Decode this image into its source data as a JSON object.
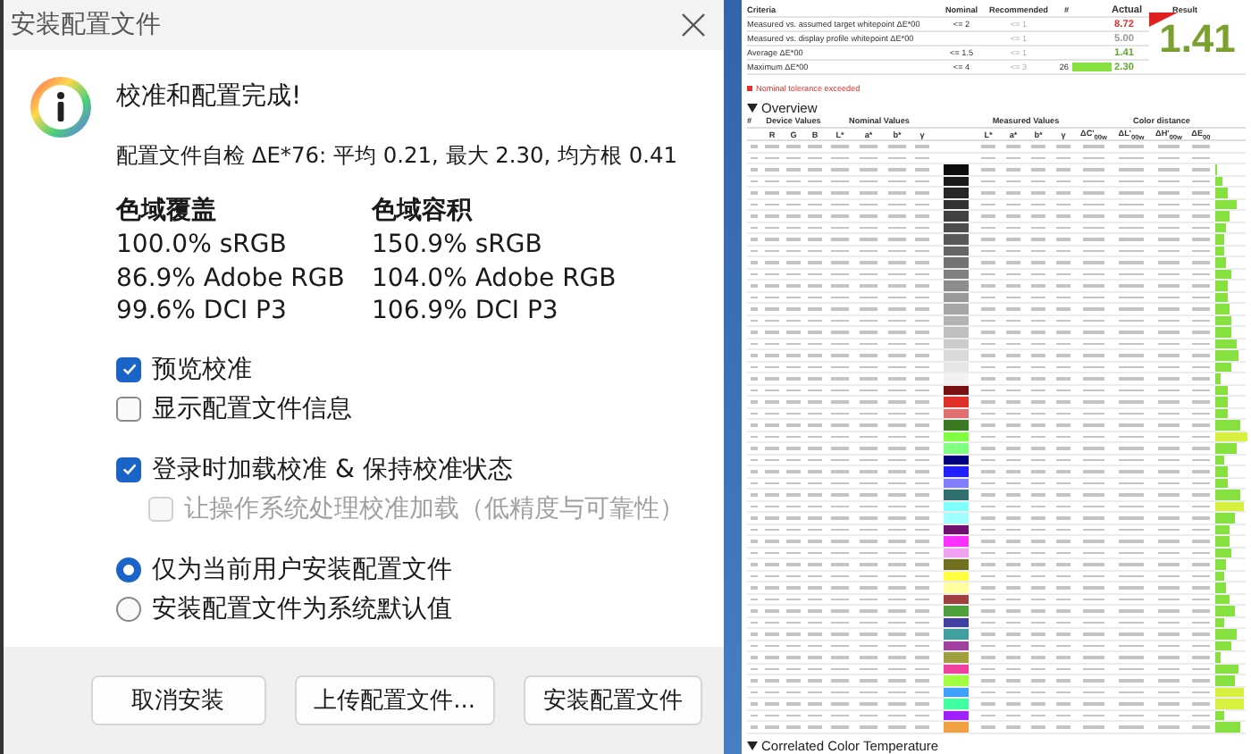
{
  "dialog": {
    "title": "安装配置文件",
    "heading": "校准和配置完成!",
    "self_check": "配置文件自检 ΔE*76: 平均 0.21, 最大 2.30, 均方根 0.41",
    "gamut": [
      {
        "title": "色域覆盖",
        "lines": [
          "100.0% sRGB",
          "86.9% Adobe RGB",
          "99.6% DCI P3"
        ]
      },
      {
        "title": "色域容积",
        "lines": [
          "150.9% sRGB",
          "104.0% Adobe RGB",
          "106.9% DCI P3"
        ]
      }
    ],
    "option_groups": [
      {
        "items": [
          {
            "kind": "checkbox",
            "label": "预览校准",
            "checked": true,
            "disabled": false
          },
          {
            "kind": "checkbox",
            "label": "显示配置文件信息",
            "checked": false,
            "disabled": false
          }
        ]
      },
      {
        "items": [
          {
            "kind": "checkbox",
            "label": "登录时加载校准 & 保持校准状态",
            "checked": true,
            "disabled": false,
            "children": [
              {
                "kind": "checkbox",
                "label": "让操作系统处理校准加载（低精度与可靠性）",
                "checked": false,
                "disabled": true
              }
            ]
          }
        ]
      },
      {
        "items": [
          {
            "kind": "radio",
            "label": "仅为当前用户安装配置文件",
            "selected": true,
            "disabled": false
          },
          {
            "kind": "radio",
            "label": "安装配置文件为系统默认值",
            "selected": false,
            "disabled": false
          }
        ]
      }
    ],
    "buttons": [
      "取消安装",
      "上传配置文件...",
      "安装配置文件"
    ]
  },
  "report": {
    "criteria": {
      "columns": [
        "Criteria",
        "Nominal",
        "Recommended",
        "#",
        "Actual",
        "Result"
      ],
      "rows": [
        {
          "criteria": "Measured vs. assumed target whitepoint ΔE*00",
          "nominal": "<= 2",
          "recommended": "<= 1",
          "actual": "8.72",
          "color": "#e03030"
        },
        {
          "criteria": "Measured vs. display profile whitepoint ΔE*00",
          "nominal": "",
          "recommended": "<= 1",
          "actual": "5.00",
          "color": "#999999"
        },
        {
          "criteria": "Average ΔE*00",
          "nominal": "<= 1.5",
          "recommended": "<= 1",
          "actual": "1.41",
          "color": "#60a830"
        },
        {
          "criteria": "Maximum ΔE*00",
          "nominal": "<= 4",
          "recommended": "<= 3",
          "number": "26",
          "level": 1,
          "actual": "2.30",
          "color": "#60a830"
        }
      ]
    },
    "result": "1.41",
    "warning": "Nominal tolerance exceeded",
    "overview": {
      "title": "Overview",
      "group_headers": [
        "#",
        "Device Values",
        "Nominal Values",
        "Measured Values",
        "Color distance"
      ],
      "device_columns": [
        "R",
        "G",
        "B"
      ],
      "nominal_columns": [
        "L*",
        "a*",
        "b*",
        "γ"
      ],
      "measured_columns": [
        "L*",
        "a*",
        "b*",
        "γ"
      ],
      "distance_columns": [
        "ΔC'$_{00w}$",
        "ΔL'$_{00w}$",
        "ΔH'$_{00w}$",
        "ΔE$_{00}$"
      ]
    },
    "next_section": "Correlated Color Temperature"
  }
}
